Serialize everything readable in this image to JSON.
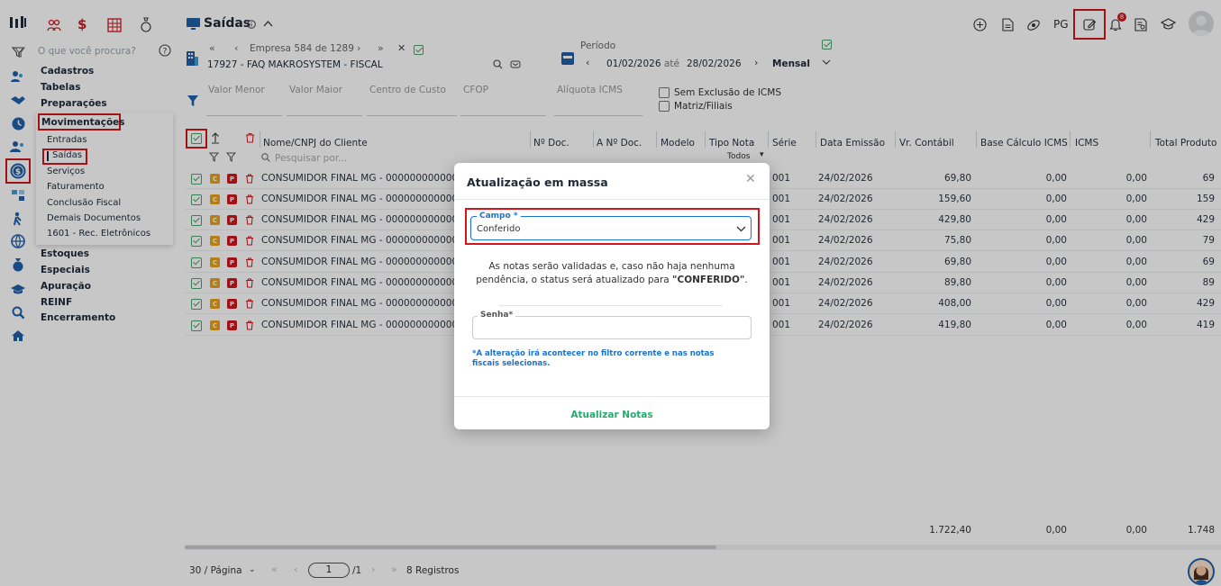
{
  "topbar": {
    "page_title": "Saídas",
    "pg_label": "PG",
    "notification_count": "8"
  },
  "search": {
    "placeholder": "O que você procura?"
  },
  "empresa": {
    "nav_label": "Empresa 584 de 1289",
    "name": "17927 - FAQ MAKROSYSTEM - FISCAL"
  },
  "periodo": {
    "label": "Período",
    "start": "01/02/2026",
    "sep": "até",
    "end": "28/02/2026",
    "mode": "Mensal"
  },
  "filters": {
    "valor_menor": "Valor Menor",
    "valor_maior": "Valor Maior",
    "centro_custo": "Centro de Custo",
    "cfop": "CFOP",
    "aliquota": "Alíquota ICMS",
    "sem_exclusao": "Sem Exclusão de ICMS",
    "matriz": "Matriz/Filiais"
  },
  "menu": {
    "cadastros": "Cadastros",
    "tabelas": "Tabelas",
    "preparacoes": "Preparações",
    "movimentacoes": "Movimentações",
    "sub": [
      "Entradas",
      "Saídas",
      "Serviços",
      "Faturamento",
      "Conclusão Fiscal",
      "Demais Documentos",
      "1601 - Rec. Eletrônicos"
    ],
    "estoques": "Estoques",
    "especiais": "Especiais",
    "apuracao": "Apuração",
    "reinf": "REINF",
    "encerramento": "Encerramento"
  },
  "table": {
    "headers": {
      "nome": "Nome/CNPJ do Cliente",
      "ndoc": "Nº Doc.",
      "andoc": "A Nº Doc.",
      "modelo": "Modelo",
      "tipo": "Tipo Nota",
      "serie": "Série",
      "data": "Data Emissão",
      "vrcontabil": "Vr. Contábil",
      "base": "Base Cálculo ICMS",
      "icms": "ICMS",
      "total": "Total Produto"
    },
    "search_placeholder": "Pesquisar por...",
    "tipo_filter": "Todos",
    "rows": [
      {
        "nome": "CONSUMIDOR FINAL MG - 00000000000000",
        "serie": "001",
        "data": "24/02/2026",
        "vr": "69,80",
        "base": "0,00",
        "icms": "0,00",
        "total": "69"
      },
      {
        "nome": "CONSUMIDOR FINAL MG - 00000000000000",
        "serie": "001",
        "data": "24/02/2026",
        "vr": "159,60",
        "base": "0,00",
        "icms": "0,00",
        "total": "159"
      },
      {
        "nome": "CONSUMIDOR FINAL MG - 00000000000000",
        "serie": "001",
        "data": "24/02/2026",
        "vr": "429,80",
        "base": "0,00",
        "icms": "0,00",
        "total": "429"
      },
      {
        "nome": "CONSUMIDOR FINAL MG - 00000000000000",
        "serie": "001",
        "data": "24/02/2026",
        "vr": "75,80",
        "base": "0,00",
        "icms": "0,00",
        "total": "79"
      },
      {
        "nome": "CONSUMIDOR FINAL MG - 00000000000000",
        "serie": "001",
        "data": "24/02/2026",
        "vr": "69,80",
        "base": "0,00",
        "icms": "0,00",
        "total": "69"
      },
      {
        "nome": "CONSUMIDOR FINAL MG - 00000000000000",
        "serie": "001",
        "data": "24/02/2026",
        "vr": "89,80",
        "base": "0,00",
        "icms": "0,00",
        "total": "89"
      },
      {
        "nome": "CONSUMIDOR FINAL MG - 00000000000000",
        "serie": "001",
        "data": "24/02/2026",
        "vr": "408,00",
        "base": "0,00",
        "icms": "0,00",
        "total": "429"
      },
      {
        "nome": "CONSUMIDOR FINAL MG - 00000000000000",
        "serie": "001",
        "data": "24/02/2026",
        "vr": "419,80",
        "base": "0,00",
        "icms": "0,00",
        "total": "419"
      }
    ],
    "totals": {
      "vr": "1.722,40",
      "base": "0,00",
      "icms": "0,00",
      "total": "1.748"
    }
  },
  "pagination": {
    "per_page": "30 / Página",
    "page": "1",
    "of": "/1",
    "records": "8 Registros"
  },
  "modal": {
    "title": "Atualização em massa",
    "campo_label": "Campo *",
    "campo_value": "Conferido",
    "message_a": "As notas serão validadas e, caso não haja nenhuma",
    "message_b": "pendência, o status será atualizado para ",
    "message_status": "\"CONFERIDO\"",
    "message_end": ".",
    "senha_label": "Senha*",
    "note": "*A alteração irá acontecer no filtro corrente e nas notas fiscais selecionas.",
    "action": "Atualizar Notas"
  },
  "colors": {
    "primary": "#1f5fa8",
    "highlight": "#d0161c",
    "success": "#27a86e",
    "link": "#1a73d0"
  }
}
